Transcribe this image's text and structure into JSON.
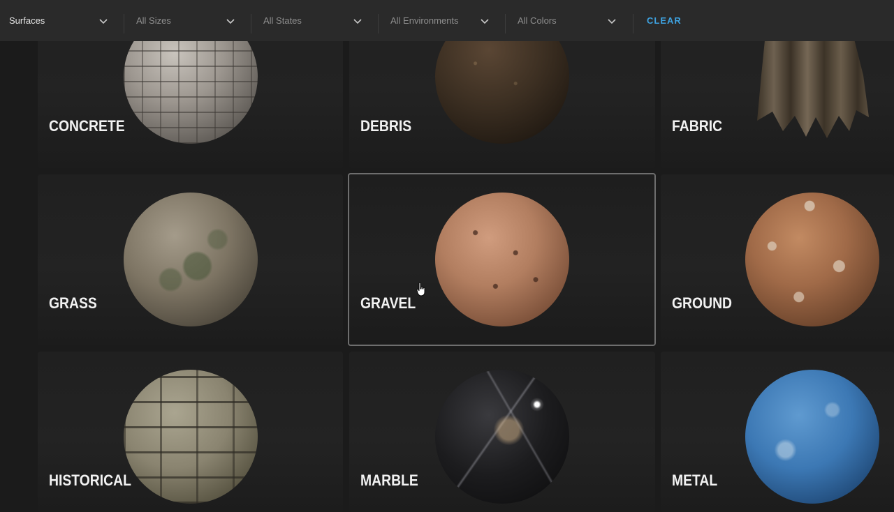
{
  "filters": [
    {
      "label": "Surfaces",
      "primary": true
    },
    {
      "label": "All Sizes",
      "primary": false
    },
    {
      "label": "All States",
      "primary": false
    },
    {
      "label": "All Environments",
      "primary": false
    },
    {
      "label": "All Colors",
      "primary": false
    }
  ],
  "clear_label": "CLEAR",
  "categories": [
    {
      "label": "CONCRETE",
      "sphere_color": "#8f8a84"
    },
    {
      "label": "DEBRIS",
      "sphere_color": "#3a2e22"
    },
    {
      "label": "FABRIC",
      "sphere_color": "#5c5040"
    },
    {
      "label": "GRASS",
      "sphere_color": "#7d7463"
    },
    {
      "label": "GRAVEL",
      "sphere_color": "#b27e60"
    },
    {
      "label": "GROUND",
      "sphere_color": "#a06a48"
    },
    {
      "label": "HISTORICAL",
      "sphere_color": "#8a8470"
    },
    {
      "label": "MARBLE",
      "sphere_color": "#1c1c1e"
    },
    {
      "label": "METAL",
      "sphere_color": "#3c78b4"
    }
  ],
  "colors": {
    "accent": "#3ea2e0",
    "background": "#1b1b1b",
    "toolbar": "#2a2a2a"
  }
}
